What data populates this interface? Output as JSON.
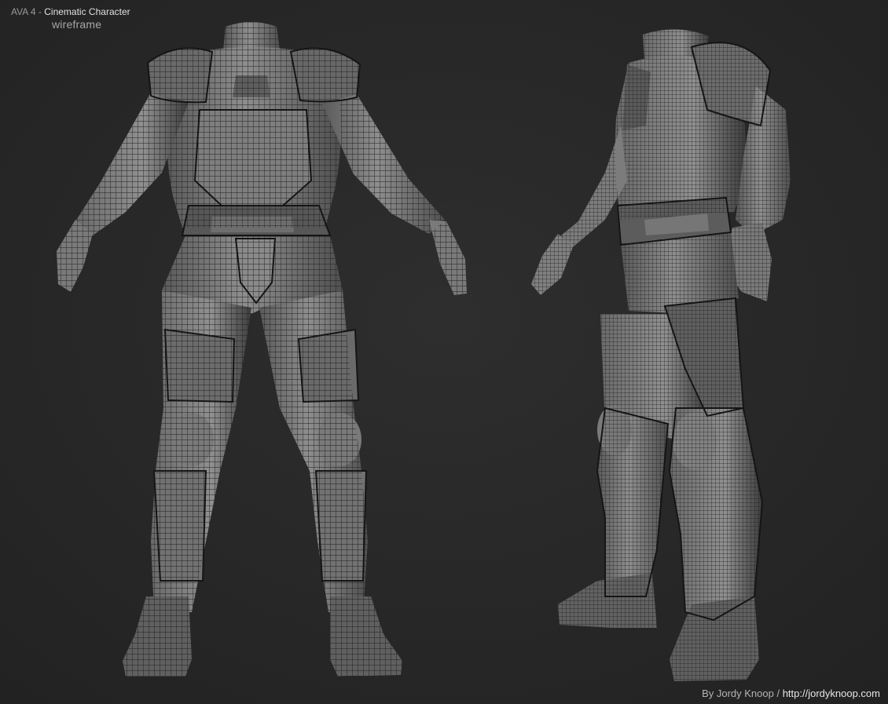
{
  "header": {
    "prefix": "AVA 4 - ",
    "title": "Cinematic Character",
    "subtitle": "wireframe"
  },
  "credit": {
    "author": "By Jordy Knoop",
    "separator": " / ",
    "url": "http://jordyknoop.com"
  },
  "colors": {
    "background": "#2a2a2a",
    "armor_light": "#8a8a8a",
    "armor_dark": "#3a3a3a",
    "wire": "#1e1e1e"
  },
  "figures": [
    "front-view-character",
    "three-quarter-view-character"
  ]
}
